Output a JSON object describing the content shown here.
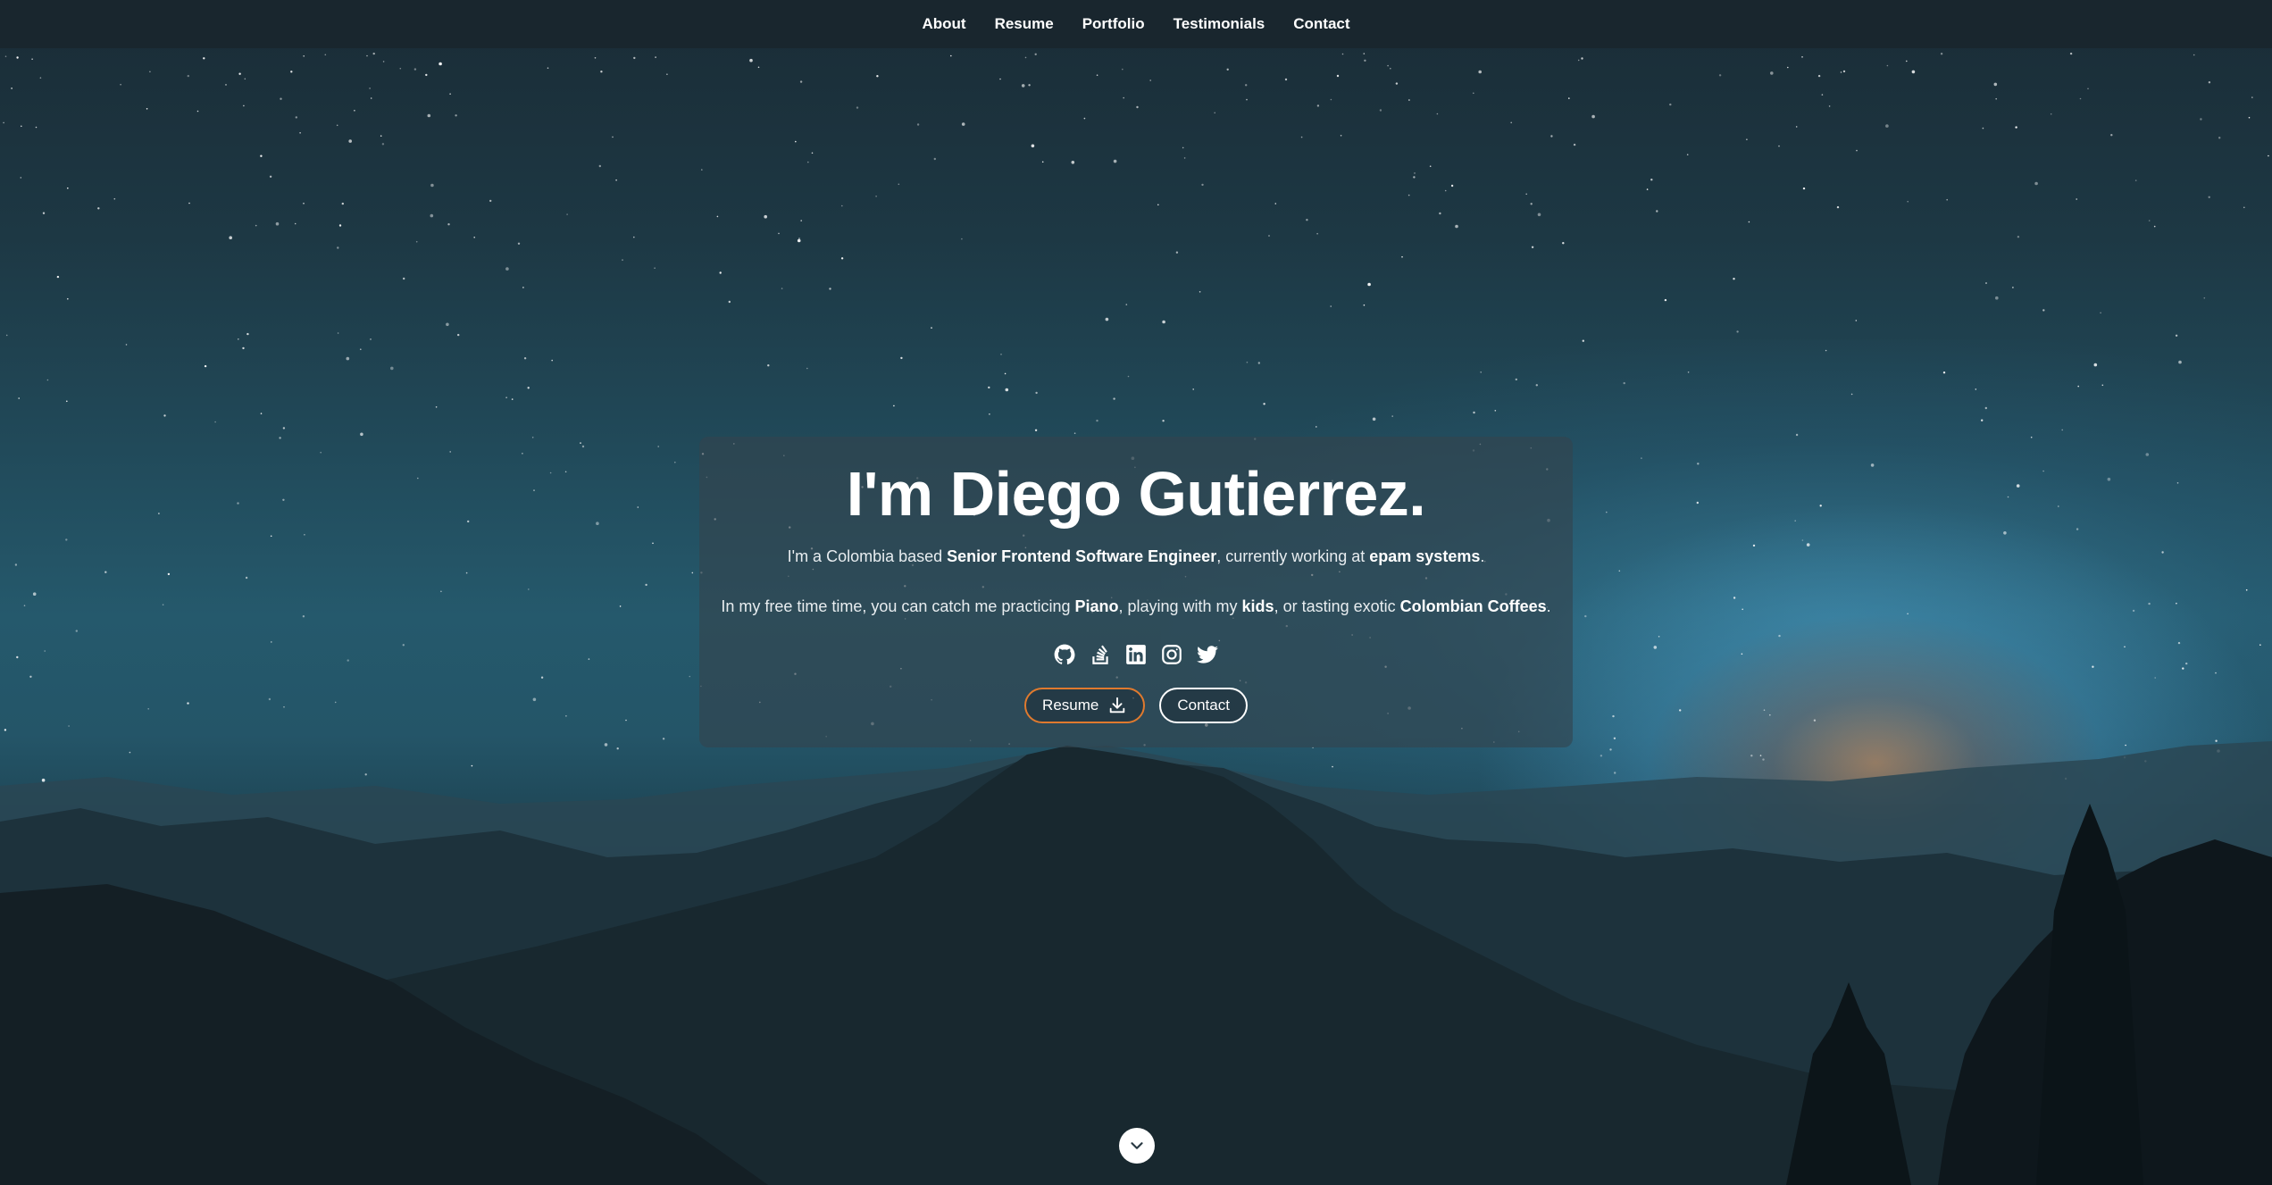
{
  "nav": {
    "items": [
      {
        "label": "About"
      },
      {
        "label": "Resume"
      },
      {
        "label": "Portfolio"
      },
      {
        "label": "Testimonials"
      },
      {
        "label": "Contact"
      }
    ]
  },
  "hero": {
    "title": "I'm Diego Gutierrez.",
    "intro": {
      "part1": "I'm a Colombia based ",
      "role": "Senior Frontend Software Engineer",
      "part2": ", currently working at ",
      "company": "epam systems",
      "part3": "."
    },
    "hobbies": {
      "part1": "In my free time time, you can catch me practicing ",
      "hobby1": "Piano",
      "part2": ", playing with my ",
      "hobby2": "kids",
      "part3": ", or tasting exotic ",
      "hobby3": "Colombian Coffees",
      "part4": "."
    },
    "socials": [
      {
        "icon": "github-icon"
      },
      {
        "icon": "stackoverflow-icon"
      },
      {
        "icon": "linkedin-icon"
      },
      {
        "icon": "instagram-icon"
      },
      {
        "icon": "twitter-icon"
      }
    ],
    "buttons": {
      "resume_label": "Resume",
      "contact_label": "Contact"
    }
  },
  "colors": {
    "accent_orange": "#e07a2e",
    "nav_bg": "#19262e",
    "text": "#ffffff"
  },
  "scroll_icon": "chevron-down-icon"
}
